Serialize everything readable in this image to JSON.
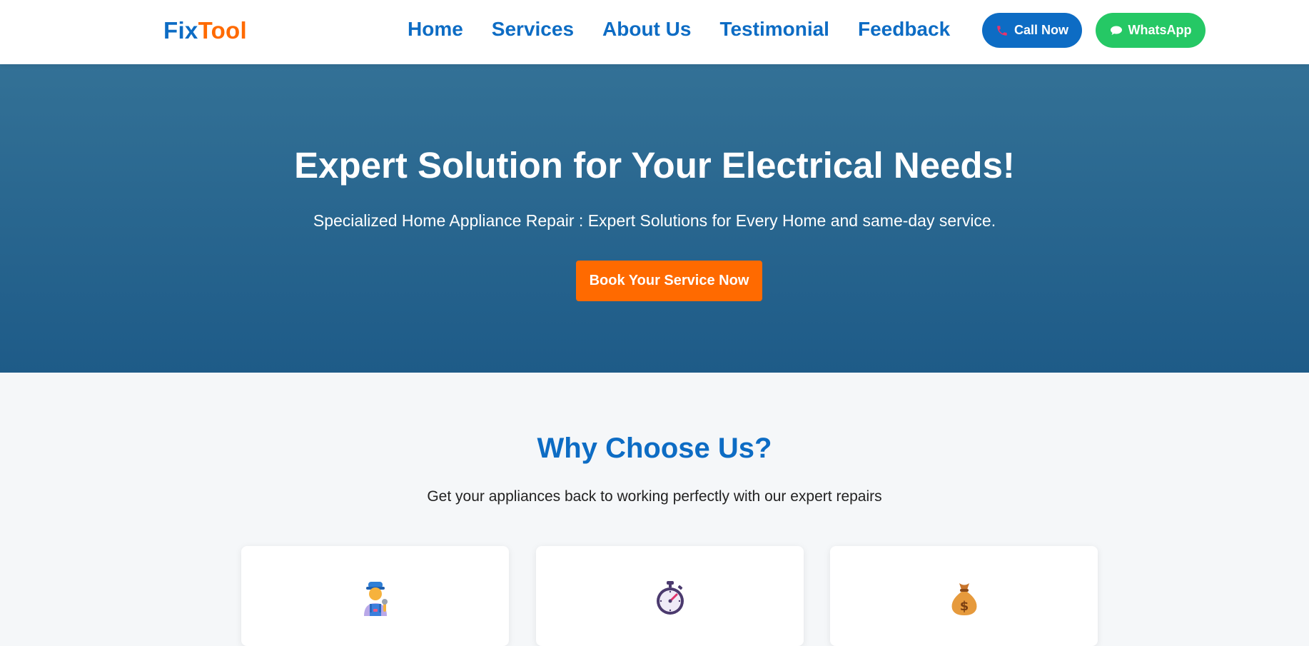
{
  "brand": {
    "part1": "Fix",
    "part2": "Tool"
  },
  "nav": {
    "links": [
      "Home",
      "Services",
      "About Us",
      "Testimonial",
      "Feedback"
    ],
    "call_label": "Call Now",
    "whatsapp_label": "WhatsApp"
  },
  "hero": {
    "title": "Expert Solution for Your Electrical Needs!",
    "subtitle": "Specialized Home Appliance Repair : Expert Solutions for Every Home and same-day service.",
    "cta_label": "Book Your Service Now"
  },
  "why": {
    "title": "Why Choose Us?",
    "subtitle": "Get your appliances back to working perfectly with our expert repairs",
    "cards": [
      {
        "icon": "technician-icon"
      },
      {
        "icon": "stopwatch-icon"
      },
      {
        "icon": "money-bag-icon"
      }
    ]
  },
  "colors": {
    "primary": "#0d6cc4",
    "accent": "#ff6a00",
    "whatsapp": "#25c865",
    "hero_top": "#337196",
    "hero_bottom": "#1e5b88"
  }
}
